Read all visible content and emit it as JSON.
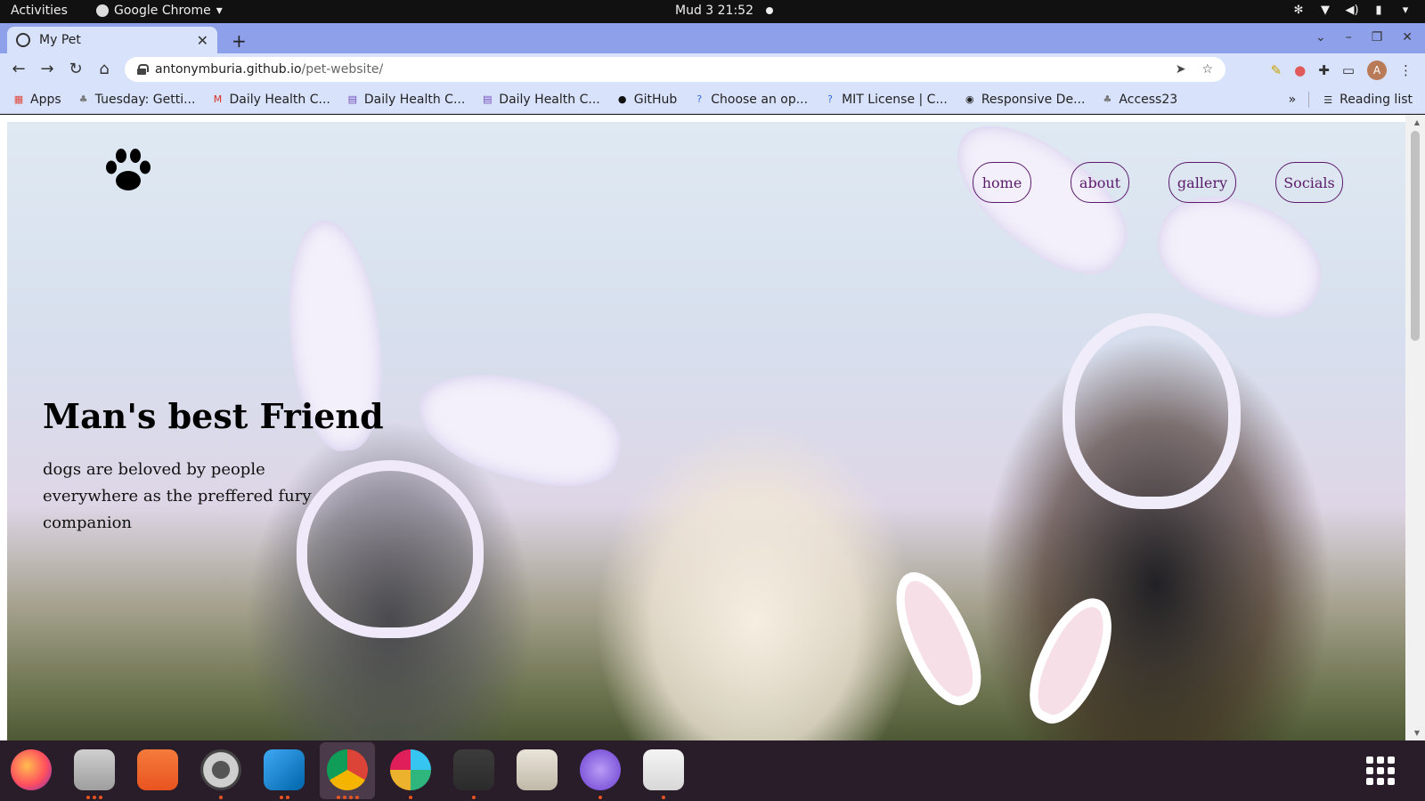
{
  "system": {
    "activities": "Activities",
    "app_name": "Google Chrome",
    "clock": "Mud 3  21:52"
  },
  "browser": {
    "tab_title": "My Pet",
    "url_host": "antonymburia.github.io",
    "url_path": "/pet-website/",
    "avatar_letter": "A",
    "bookmarks": [
      {
        "label": "Apps",
        "icon": "apps-grid-icon"
      },
      {
        "label": "Tuesday: Getti...",
        "icon": "tree-icon"
      },
      {
        "label": "Daily Health C...",
        "icon": "gmail-icon"
      },
      {
        "label": "Daily Health C...",
        "icon": "form-icon"
      },
      {
        "label": "Daily Health C...",
        "icon": "form-icon"
      },
      {
        "label": "GitHub",
        "icon": "github-icon"
      },
      {
        "label": "Choose an op...",
        "icon": "question-icon"
      },
      {
        "label": "MIT License | C...",
        "icon": "question-icon"
      },
      {
        "label": "Responsive De...",
        "icon": "globe-icon"
      },
      {
        "label": "Access23",
        "icon": "tree-icon"
      }
    ],
    "reading_list": "Reading list"
  },
  "site": {
    "nav": [
      {
        "label": "home"
      },
      {
        "label": "about"
      },
      {
        "label": "gallery"
      },
      {
        "label": "Socials"
      }
    ],
    "hero_title": "Man's best Friend",
    "hero_text": "dogs are beloved by people everywhere as the preffered fury companion",
    "accent_color": "#5a1a6a"
  },
  "dock": [
    {
      "name": "firefox-icon"
    },
    {
      "name": "files-icon"
    },
    {
      "name": "software-icon"
    },
    {
      "name": "settings-icon"
    },
    {
      "name": "vscode-icon"
    },
    {
      "name": "chrome-icon"
    },
    {
      "name": "slack-icon"
    },
    {
      "name": "terminal-icon"
    },
    {
      "name": "image-viewer-icon"
    },
    {
      "name": "browser-icon"
    },
    {
      "name": "text-editor-icon"
    }
  ]
}
